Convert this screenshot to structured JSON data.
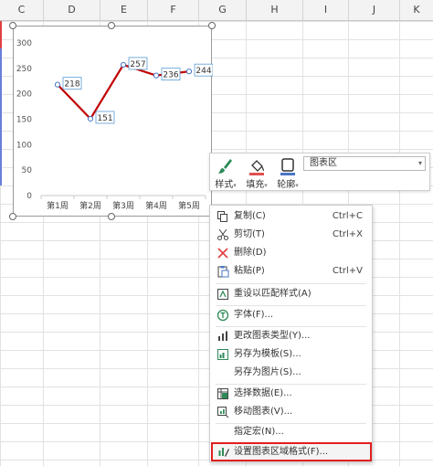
{
  "columns": [
    "C",
    "D",
    "E",
    "F",
    "G",
    "H",
    "I",
    "J",
    "K"
  ],
  "chart_data": {
    "type": "line",
    "categories": [
      "第1周",
      "第2周",
      "第3周",
      "第4周",
      "第5周"
    ],
    "values": [
      218,
      151,
      257,
      236,
      244
    ],
    "data_labels": [
      "218",
      "151",
      "257",
      "236",
      "244"
    ],
    "ylim": [
      0,
      300
    ],
    "yticks": [
      "0",
      "50",
      "100",
      "150",
      "200",
      "250",
      "300"
    ],
    "line_color": "#c00000",
    "label_border_color": "#5b9bd5",
    "grid": false,
    "title": "",
    "xlabel": "",
    "ylabel": ""
  },
  "mini_toolbar": {
    "style_label": "样式",
    "fill_label": "填充",
    "outline_label": "轮廓",
    "element_select": "图表区",
    "style_icon": "brush-icon",
    "fill_icon": "paint-bucket-icon",
    "outline_icon": "outline-icon"
  },
  "context_menu": {
    "copy": {
      "label": "复制(C)",
      "shortcut": "Ctrl+C",
      "icon": "copy-icon"
    },
    "cut": {
      "label": "剪切(T)",
      "shortcut": "Ctrl+X",
      "icon": "scissors-icon"
    },
    "delete": {
      "label": "删除(D)",
      "icon": "delete-x-icon"
    },
    "paste": {
      "label": "粘贴(P)",
      "shortcut": "Ctrl+V",
      "icon": "paste-icon"
    },
    "reset_style": {
      "label": "重设以匹配样式(A)",
      "icon": "reset-style-icon"
    },
    "font": {
      "label": "字体(F)...",
      "icon": "font-icon"
    },
    "change_type": {
      "label": "更改图表类型(Y)...",
      "icon": "chart-type-icon"
    },
    "save_template": {
      "label": "另存为模板(S)...",
      "icon": "save-template-icon"
    },
    "save_picture": {
      "label": "另存为图片(S)..."
    },
    "select_data": {
      "label": "选择数据(E)...",
      "icon": "select-data-icon"
    },
    "move_chart": {
      "label": "移动图表(V)...",
      "icon": "move-chart-icon"
    },
    "assign_macro": {
      "label": "指定宏(N)..."
    },
    "format_chart_area": {
      "label": "设置图表区域格式(F)...",
      "icon": "format-area-icon"
    }
  },
  "colors": {
    "highlight_border": "#e02020",
    "accent_green": "#2e8b57"
  }
}
